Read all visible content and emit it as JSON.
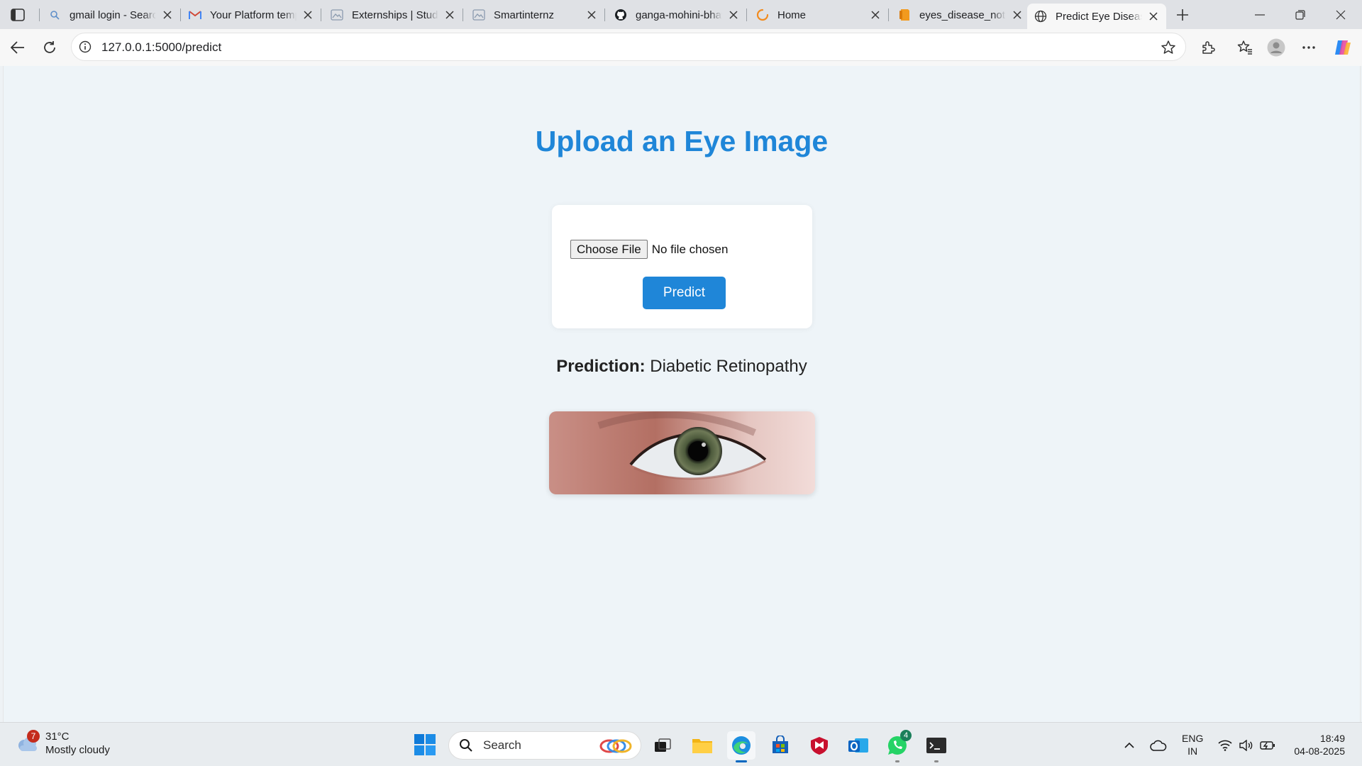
{
  "browser": {
    "tabs": [
      {
        "title": "gmail login - Search",
        "icon": "search-favicon",
        "active": false
      },
      {
        "title": "Your Platform template",
        "icon": "gmail-favicon",
        "active": false
      },
      {
        "title": "Externships | Student",
        "icon": "image-favicon",
        "active": false
      },
      {
        "title": "Smartinternz",
        "icon": "image-favicon",
        "active": false
      },
      {
        "title": "ganga-mohini-bhavani",
        "icon": "github-favicon",
        "active": false
      },
      {
        "title": "Home",
        "icon": "loading-favicon",
        "active": false
      },
      {
        "title": "eyes_disease_notebook",
        "icon": "notebook-favicon",
        "active": false
      },
      {
        "title": "Predict Eye Disease",
        "icon": "globe-favicon",
        "active": true
      }
    ],
    "address": {
      "url": "127.0.0.1:5000/predict"
    }
  },
  "page": {
    "heading": "Upload an Eye Image",
    "upload": {
      "choose_label": "Choose File",
      "file_status": "No file chosen"
    },
    "predict_button": "Predict",
    "prediction": {
      "label": "Prediction:",
      "value": "Diabetic Retinopathy"
    },
    "image_alt": "Uploaded eye image"
  },
  "taskbar": {
    "weather": {
      "temp": "31°C",
      "condition": "Mostly cloudy",
      "badge": "7"
    },
    "search_placeholder": "Search",
    "whatsapp_badge": "4",
    "language": {
      "line1": "ENG",
      "line2": "IN"
    },
    "clock": {
      "time": "18:49",
      "date": "04-08-2025"
    }
  },
  "colors": {
    "accent": "#1f86d8",
    "page_bg": "#eef4f8"
  }
}
